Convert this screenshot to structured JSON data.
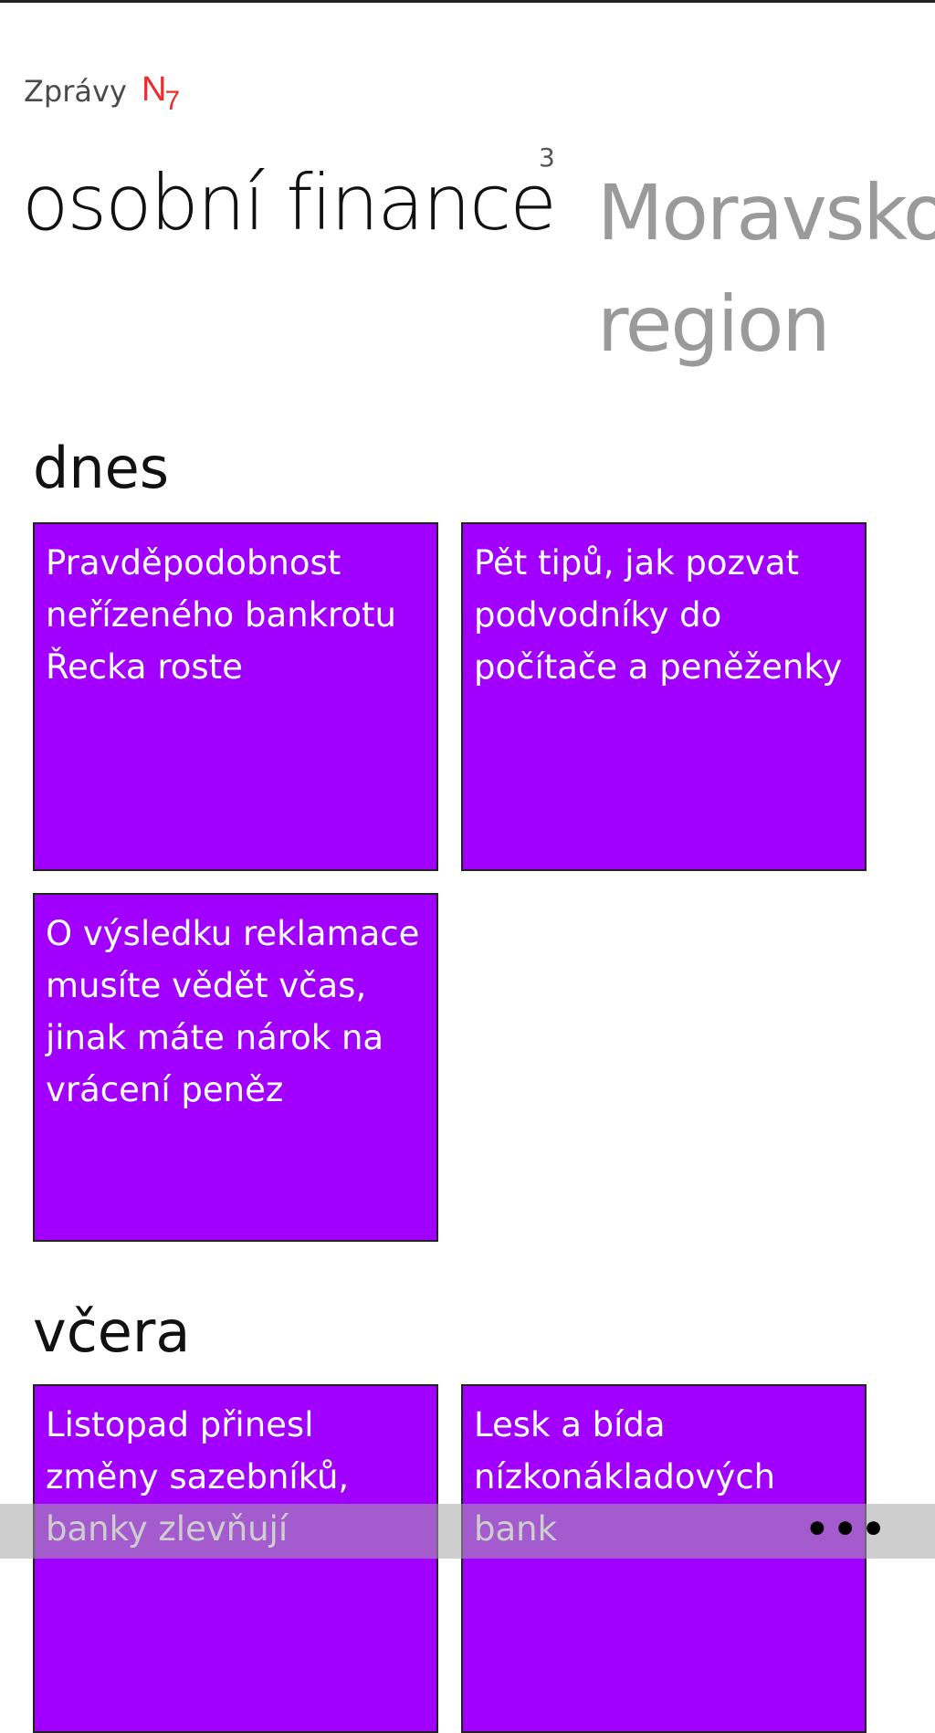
{
  "header": {
    "app_title": "Zprávy",
    "logo_letter": "N",
    "logo_sub": "7"
  },
  "pivot": {
    "current": "osobní finance",
    "current_count": "3",
    "next_line1": "Moravsko",
    "next_line2": "region"
  },
  "sections": [
    {
      "title": "dnes",
      "articles": [
        "Pravděpodobnost neřízeného bankrotu Řecka roste",
        "Pět tipů, jak pozvat podvodníky do počítače a peněženky",
        "O výsledku reklamace musíte vědět včas, jinak máte nárok na vrácení peněz"
      ]
    },
    {
      "title": "včera",
      "articles": [
        "Listopad přinesl změny sazebníků, banky zlevňují",
        "Lesk a bída nízkonákladových bank"
      ]
    }
  ],
  "appbar": {
    "more": "•••"
  },
  "colors": {
    "tile": "#a100ff",
    "accent_logo": "#ef2b2b"
  }
}
